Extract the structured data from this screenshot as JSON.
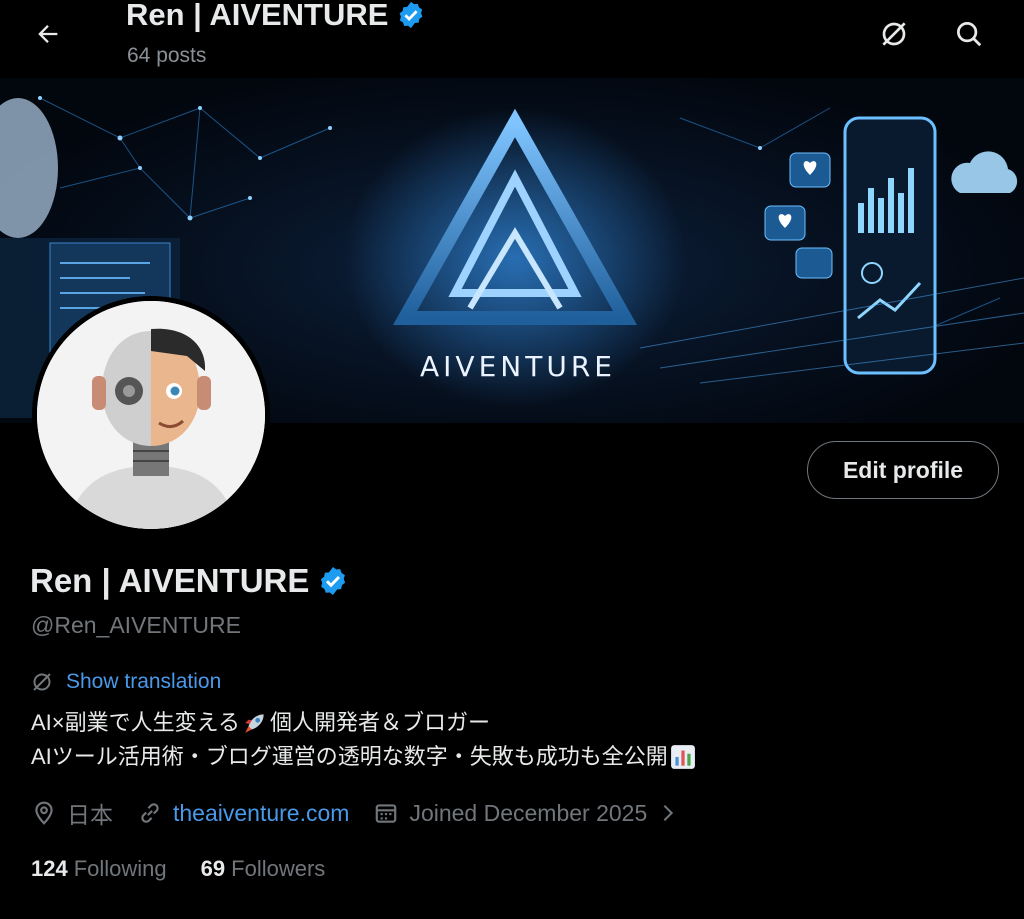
{
  "header": {
    "title": "Ren | AIVENTURE",
    "posts_count": "64 posts"
  },
  "banner": {
    "brand_text": "AIVENTURE"
  },
  "profile": {
    "name": "Ren | AIVENTURE",
    "handle": "@Ren_AIVENTURE",
    "edit_label": "Edit profile",
    "show_translation": "Show translation",
    "bio_line1": "AI×副業で人生変える",
    "bio_line1_b": " 個人開発者＆ブロガー",
    "bio_line2": "AIツール活用術・ブログ運営の透明な数字・失敗も成功も全公開",
    "location": "日本",
    "website": "theaiventure.com",
    "joined": "Joined December 2025",
    "following_count": "124",
    "following_label": "Following",
    "followers_count": "69",
    "followers_label": "Followers"
  },
  "icons": [
    "back-arrow-icon",
    "translate-icon",
    "search-icon",
    "verified-badge-icon",
    "location-icon",
    "link-icon",
    "calendar-icon",
    "chevron-right-icon",
    "rocket-icon",
    "chart-icon"
  ],
  "colors": {
    "background": "#000000",
    "text": "#e7e9ea",
    "muted": "#71767b",
    "link": "#4a99e9",
    "verified": "#1d9bf0"
  }
}
